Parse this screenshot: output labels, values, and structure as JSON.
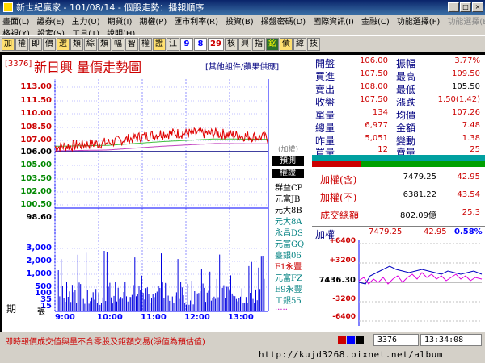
{
  "window": {
    "title": "新世紀贏家 - 101/08/14 - 個股走勢：播報順序"
  },
  "menu": {
    "row1": [
      "畫面(L)",
      "證券(E)",
      "主力(U)",
      "期貨(I)",
      "期權(P)",
      "匯市利率(R)",
      "投資(B)",
      "操盤密碼(D)",
      "國際資訊(I)",
      "金融(C)",
      "功能選擇(F)",
      "功能選擇(E)"
    ],
    "row2": [
      "格視(Y)",
      "設定(S)",
      "工具(T)",
      "說明(H)"
    ]
  },
  "toolbar": [
    "加",
    "權",
    "即",
    "價",
    "選",
    "類",
    "綜",
    "類",
    "幅",
    "智",
    "權",
    "證",
    "江",
    "9",
    "8",
    "29",
    "核",
    "興",
    "指",
    "銘",
    "債",
    "緯",
    "技"
  ],
  "chart": {
    "code": "[3376]",
    "title": "新日興  量價走勢圖",
    "tag": "[其他組件/蘋果供應]",
    "price_ticks": [
      "113.00",
      "111.50",
      "110.00",
      "108.50",
      "107.00",
      "106.00",
      "105.00",
      "103.50",
      "102.00",
      "100.50",
      "98.60"
    ],
    "vol_ticks": [
      "3,000",
      "2,000",
      "1,000",
      "500",
      "100",
      "35",
      "15"
    ],
    "time_ticks": [
      "9:00",
      "10:00",
      "11:00",
      "12:00",
      "13:00"
    ],
    "vol_label_left": "期",
    "vol_label_right": "張",
    "marker": "(加權)",
    "right_tags": [
      "預測",
      "權證"
    ],
    "brokers": [
      "群益CP",
      "元富JB",
      "元大8B",
      "元大8A",
      "永昌DS",
      "元富GQ",
      "臺銀06",
      "F1永豐",
      "元富FZ",
      "E9永豐",
      "工銀55",
      "....."
    ]
  },
  "chart_data": {
    "type": "line",
    "x": [
      "9:00",
      "10:00",
      "11:00",
      "12:00",
      "13:00"
    ],
    "series": [
      {
        "name": "price",
        "values": [
          106.5,
          107.0,
          108.0,
          108.0,
          107.5
        ]
      },
      {
        "name": "avg",
        "values": [
          106.5,
          106.6,
          107.0,
          107.3,
          107.26
        ]
      }
    ],
    "ylim": [
      98.6,
      113.0
    ]
  },
  "quote": {
    "rows": [
      [
        "開盤",
        "106.00",
        "振幅",
        "3.77%"
      ],
      [
        "買進",
        "107.50",
        "最高",
        "109.50"
      ],
      [
        "賣出",
        "108.00",
        "最低",
        "105.50"
      ],
      [
        "收盤",
        "107.50",
        "漲跌",
        "1.50(1.42)"
      ],
      [
        "單量",
        "134",
        "均價",
        "107.26"
      ],
      [
        "總量",
        "6,977",
        "金額",
        "7.48"
      ],
      [
        "昨量",
        "5,051",
        "變動",
        "1.38"
      ],
      [
        "買量",
        "12",
        "賣量",
        "25"
      ]
    ],
    "index_rows": [
      [
        "加權(含)",
        "7479.25",
        "42.95"
      ],
      [
        "加權(不)",
        "6381.22",
        "43.54"
      ],
      [
        "成交總額",
        "802.09億",
        "25.3"
      ]
    ],
    "index_head": {
      "label": "加權",
      "value": "7479.25",
      "change": "42.95",
      "pct": "0.58%"
    },
    "index_ticks": [
      "+6400",
      "+3200",
      "7436.30",
      "-3200",
      "-6400"
    ]
  },
  "status": {
    "message": "即時報價成交值與量不含零股及鉅額交易(淨值為預估值)",
    "code": "3376",
    "time": "13:34:08"
  },
  "watermark": "http://kujd3268.pixnet.net/album",
  "colors": {
    "up": "#cc0000",
    "down": "#008000",
    "base": "#000080"
  }
}
